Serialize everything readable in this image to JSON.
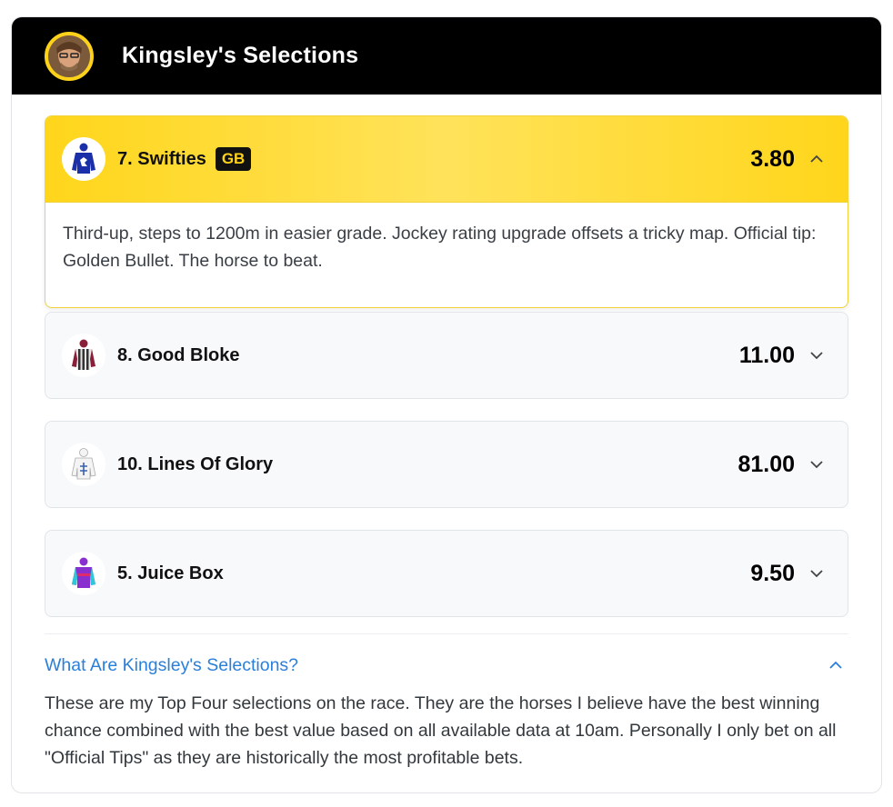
{
  "header": {
    "title": "Kingsley's Selections"
  },
  "selections": [
    {
      "name": "7. Swifties",
      "badge": "GB",
      "odds": "3.80",
      "expanded": true,
      "comment": "Third-up, steps to 1200m in easier grade. Jockey rating upgrade offsets a tricky map. Official tip: Golden Bullet. The horse to beat."
    },
    {
      "name": "8. Good Bloke",
      "odds": "11.00",
      "expanded": false
    },
    {
      "name": "10. Lines Of Glory",
      "odds": "81.00",
      "expanded": false
    },
    {
      "name": "5. Juice Box",
      "odds": "9.50",
      "expanded": false
    }
  ],
  "faq": {
    "question": "What Are Kingsley's Selections?",
    "answer": "These are my Top Four selections on the race. They are the horses I believe have the best winning chance combined with the best value based on all available data at 10am. Personally I only bet on all \"Official Tips\" as they are historically the most profitable bets."
  },
  "colors": {
    "accent": "#ffd61b",
    "link": "#2a7fd9",
    "header_bg": "#000000"
  }
}
